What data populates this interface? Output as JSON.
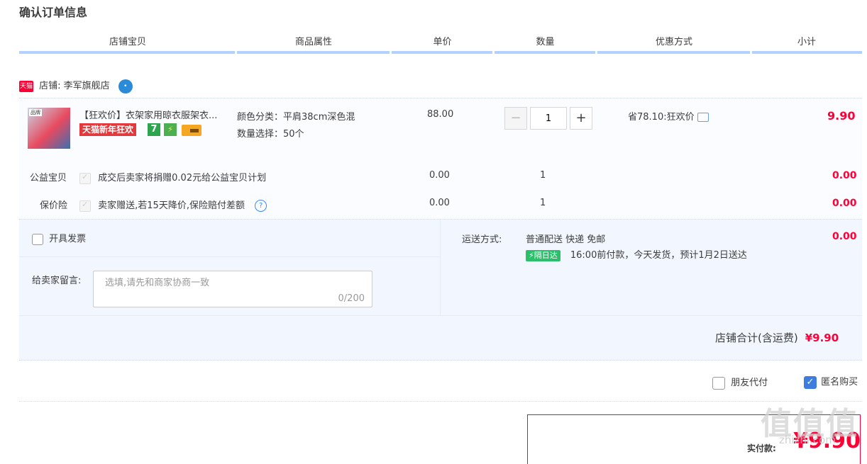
{
  "page": {
    "title": "确认订单信息"
  },
  "header": {
    "columns": [
      "店铺宝贝",
      "商品属性",
      "单价",
      "数量",
      "优惠方式",
      "小计"
    ]
  },
  "shop": {
    "badge": "天猫",
    "label": "店铺:",
    "name": "李军旗舰店"
  },
  "item": {
    "title": "【狂欢价】衣架家用晾衣服架衣...",
    "promo_tag": "天猫新年狂欢",
    "tag_seven": "7",
    "attr_color": "颜色分类：平肩38cm深色混",
    "attr_qty": "数量选择：50个",
    "unit_price": "88.00",
    "quantity": "1",
    "discount": "省78.10:狂欢价",
    "subtotal": "9.90",
    "thumb_label": "品牌"
  },
  "charity": {
    "label": "公益宝贝",
    "text": "成交后卖家将捐赠0.02元给公益宝贝计划",
    "price": "0.00",
    "qty": "1",
    "subtotal": "0.00"
  },
  "insurance": {
    "label": "保价险",
    "text": "卖家赠送,若15天降价,保险赔付差额",
    "help": "?",
    "price": "0.00",
    "qty": "1",
    "subtotal": "0.00"
  },
  "invoice": {
    "label": "开具发票"
  },
  "message": {
    "label": "给卖家留言:",
    "placeholder": "选填,请先和商家协商一致",
    "value": "",
    "count": "0/200"
  },
  "shipping": {
    "label": "运送方式:",
    "method": "普通配送 快递 免邮",
    "badge": "隔日达",
    "note": "16:00前付款，今天发货，预计1月2日送达",
    "fee": "0.00"
  },
  "shop_total": {
    "label": "店铺合计(含运费)",
    "amount": "¥9.90"
  },
  "options": {
    "friend_pay": "朋友代付",
    "anonymous": "匿名购买"
  },
  "pay": {
    "label": "实付款:",
    "amount": "¥9.90"
  },
  "watermark": {
    "text": "值值值",
    "domain": "zhizhi.com"
  },
  "colors": {
    "accent_red": "#ff0036",
    "header_bar": "#b2d1ff",
    "check_blue": "#3d7dde"
  }
}
